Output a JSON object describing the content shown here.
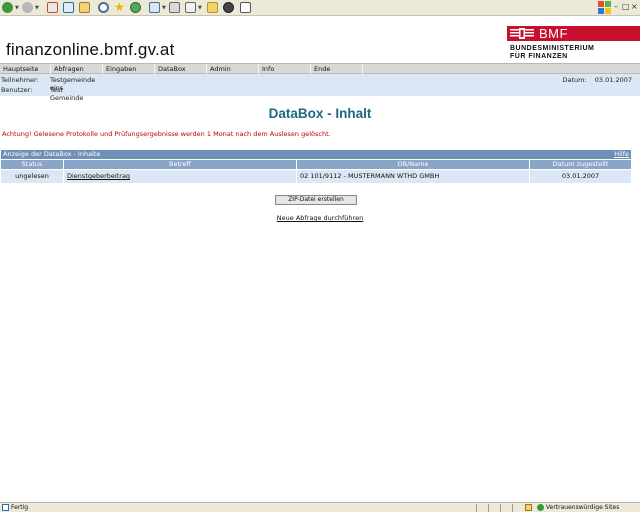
{
  "browser": {
    "icons": [
      "back-icon",
      "forward-icon",
      "stop-icon",
      "refresh-icon",
      "home-icon",
      "search-icon",
      "favorites-icon",
      "history-icon",
      "mail-icon",
      "print-icon",
      "edit-icon",
      "folder-icon",
      "messenger-icon",
      "page-icon"
    ],
    "window_controls": [
      "–",
      "□",
      "×"
    ]
  },
  "site": {
    "title": "finanzonline.bmf.gv.at",
    "logo": {
      "abbr": "BMF",
      "line1": "BUNDESMINISTERIUM",
      "line2": "FÜR FINANZEN",
      "color": "#c8102e"
    }
  },
  "nav": [
    "Hauptseite",
    "Abfragen",
    "Eingaben",
    "DataBox",
    "Admin",
    "Info",
    "Ende"
  ],
  "info": {
    "participant_label": "Teilnehmer:",
    "participant_value": "Testgemeinde eins",
    "user_label": "Benutzer:",
    "user_value": "Test Gemeinde",
    "date_label": "Datum:",
    "date_value": "03.01.2007"
  },
  "page": {
    "title": "DataBox - Inhalt",
    "warning": "Achtung! Gelesene Protokolle und Prüfungsergebnisse werden 1 Monat nach dem Auslesen gelöscht."
  },
  "table": {
    "section_title": "Anzeige der DataBox - Inhalte",
    "help_label": "Hilfe",
    "headers": [
      "Status",
      "Betreff",
      "OB/Name",
      "Datum zugestellt"
    ],
    "rows": [
      {
        "status": "ungelesen",
        "subject": "Dienstgeberbeitrag",
        "ob_name": "02 101/9112 - MUSTERMANN WTHD GMBH",
        "date": "03.01.2007"
      }
    ]
  },
  "actions": {
    "zip_button": "ZIP-Datei erstellen",
    "new_query": "Neue Abfrage durchführen"
  },
  "statusbar": {
    "left": "Fertig",
    "zone": "Vertrauenswürdige Sites"
  },
  "colors": {
    "title_teal": "#1c6a80",
    "warning_red": "#c00000",
    "header_blue": "#6f90b8",
    "row_blue": "#dbe7f4"
  }
}
